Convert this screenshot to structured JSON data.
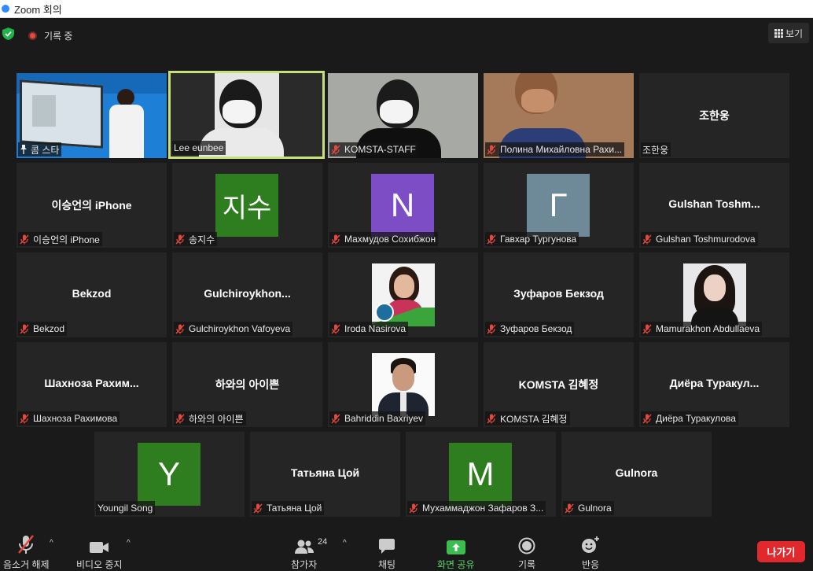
{
  "window": {
    "title": "Zoom 회의"
  },
  "topbar": {
    "recording_label": "기록 중",
    "view_label": "보기"
  },
  "colors": {
    "active_border": "#c8e07a",
    "share_green": "#5ad468",
    "end_red": "#e0282d",
    "mic_off_red": "#e8473c"
  },
  "tiles": [
    {
      "name": "콤 스타",
      "center": "",
      "avatar_letter": "",
      "avatar_color": "",
      "muted": false,
      "pinned": true,
      "kind": "video-presenter"
    },
    {
      "name": "Lee eunbee",
      "center": "",
      "avatar_letter": "",
      "avatar_color": "",
      "muted": false,
      "pinned": false,
      "kind": "video-person",
      "active": true
    },
    {
      "name": "KOMSTA-STAFF",
      "center": "",
      "avatar_letter": "",
      "avatar_color": "",
      "muted": true,
      "pinned": false,
      "kind": "video-person"
    },
    {
      "name": "Полина Михайловна Рахи...",
      "center": "",
      "avatar_letter": "",
      "avatar_color": "",
      "muted": true,
      "pinned": false,
      "kind": "video-person"
    },
    {
      "name": "조한웅",
      "center": "조한웅",
      "avatar_letter": "",
      "avatar_color": "",
      "muted": false,
      "pinned": false,
      "kind": "name"
    },
    {
      "name": "이승언의 iPhone",
      "center": "이승언의 iPhone",
      "avatar_letter": "",
      "avatar_color": "",
      "muted": true,
      "pinned": false,
      "kind": "name"
    },
    {
      "name": "송지수",
      "center": "",
      "avatar_letter": "지수",
      "avatar_color": "#2e7d1e",
      "muted": true,
      "pinned": false,
      "kind": "avatar"
    },
    {
      "name": "Махмудов Сохибжон",
      "center": "",
      "avatar_letter": "N",
      "avatar_color": "#7c4dc4",
      "muted": true,
      "pinned": false,
      "kind": "avatar"
    },
    {
      "name": "Гавхар Тургунова",
      "center": "",
      "avatar_letter": "Г",
      "avatar_color": "#6e8a99",
      "muted": true,
      "pinned": false,
      "kind": "avatar"
    },
    {
      "name": "Gulshan Toshmurodova",
      "center": "Gulshan Toshm...",
      "avatar_letter": "",
      "avatar_color": "",
      "muted": true,
      "pinned": false,
      "kind": "name"
    },
    {
      "name": "Bekzod",
      "center": "Bekzod",
      "avatar_letter": "",
      "avatar_color": "",
      "muted": true,
      "pinned": false,
      "kind": "name"
    },
    {
      "name": "Gulchiroykhon Vafoyeva",
      "center": "Gulchiroykhon...",
      "avatar_letter": "",
      "avatar_color": "",
      "muted": true,
      "pinned": false,
      "kind": "name"
    },
    {
      "name": "Iroda Nasirova",
      "center": "",
      "avatar_letter": "",
      "avatar_color": "",
      "muted": true,
      "pinned": false,
      "kind": "photo-woman-flag"
    },
    {
      "name": "Зуфаров Бекзод",
      "center": "Зуфаров Бекзод",
      "avatar_letter": "",
      "avatar_color": "",
      "muted": true,
      "pinned": false,
      "kind": "name"
    },
    {
      "name": "Mamurakhon Abdullaeva",
      "center": "",
      "avatar_letter": "",
      "avatar_color": "",
      "muted": true,
      "pinned": false,
      "kind": "photo-woman"
    },
    {
      "name": "Шахноза Рахимова",
      "center": "Шахноза Рахим...",
      "avatar_letter": "",
      "avatar_color": "",
      "muted": true,
      "pinned": false,
      "kind": "name"
    },
    {
      "name": "하와의 아이쁜",
      "center": "하와의 아이쁜",
      "avatar_letter": "",
      "avatar_color": "",
      "muted": true,
      "pinned": false,
      "kind": "name"
    },
    {
      "name": "Bahriddin Baxriyev",
      "center": "",
      "avatar_letter": "",
      "avatar_color": "",
      "muted": true,
      "pinned": false,
      "kind": "photo-man"
    },
    {
      "name": "KOMSTA 김혜정",
      "center": "KOMSTA 김혜정",
      "avatar_letter": "",
      "avatar_color": "",
      "muted": true,
      "pinned": false,
      "kind": "name"
    },
    {
      "name": "Диёра Туракулова",
      "center": "Диёра Туракул...",
      "avatar_letter": "",
      "avatar_color": "",
      "muted": true,
      "pinned": false,
      "kind": "name"
    },
    {
      "name": "Youngil Song",
      "center": "",
      "avatar_letter": "Y",
      "avatar_color": "#2e7d1e",
      "muted": false,
      "pinned": false,
      "kind": "avatar"
    },
    {
      "name": "Татьяна Цой",
      "center": "Татьяна Цой",
      "avatar_letter": "",
      "avatar_color": "",
      "muted": true,
      "pinned": false,
      "kind": "name"
    },
    {
      "name": "Мухаммаджон Зафаров З...",
      "center": "",
      "avatar_letter": "M",
      "avatar_color": "#2e7d1e",
      "muted": true,
      "pinned": false,
      "kind": "avatar"
    },
    {
      "name": "Gulnora",
      "center": "Gulnora",
      "avatar_letter": "",
      "avatar_color": "",
      "muted": true,
      "pinned": false,
      "kind": "name"
    }
  ],
  "controls": {
    "mute_label": "음소거 해제",
    "video_label": "비디오 중지",
    "participants_label": "참가자",
    "participants_count": "24",
    "chat_label": "채팅",
    "share_label": "화면 공유",
    "record_label": "기록",
    "reactions_label": "반응",
    "end_label": "나가기"
  }
}
